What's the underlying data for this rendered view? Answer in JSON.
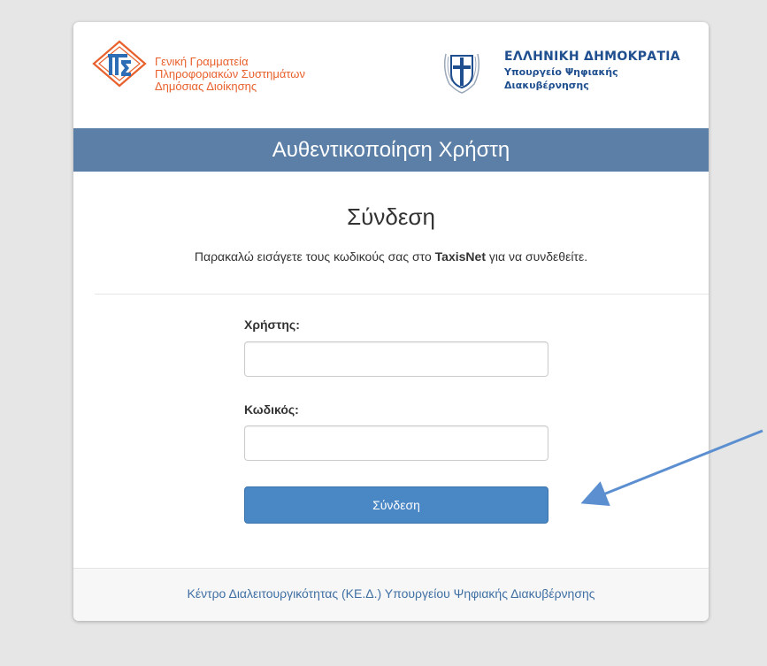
{
  "header": {
    "org_logo": {
      "icon": "gsis-logo-icon",
      "lines": [
        "Γενική Γραμματεία",
        "Πληροφοριακών Συστημάτων",
        "Δημόσιας Διοίκησης"
      ],
      "color": "#e8602c"
    },
    "gov_logo": {
      "icon": "greek-emblem-icon",
      "title": "ΕΛΛΗΝΙΚΗ ΔΗΜΟΚΡΑΤΙΑ",
      "subtitle_lines": [
        "Υπουργείο Ψηφιακής",
        "Διακυβέρνησης"
      ],
      "color": "#1f4f8f"
    }
  },
  "banner": {
    "title": "Αυθεντικοποίηση Χρήστη",
    "color": "#5b7fa6"
  },
  "login": {
    "heading": "Σύνδεση",
    "instruction_before": "Παρακαλώ εισάγετε τους κωδικούς σας στο ",
    "instruction_bold": "TaxisNet",
    "instruction_after": " για να συνδεθείτε.",
    "username_label": "Χρήστης:",
    "username_value": "",
    "password_label": "Κωδικός:",
    "password_value": "",
    "submit_label": "Σύνδεση",
    "button_color": "#4a87c5"
  },
  "footer": {
    "text": "Κέντρο Διαλειτουργικότητας (ΚΕ.Δ.) Υπουργείου Ψηφιακής Διακυβέρνησης",
    "color": "#3f6fa3"
  },
  "annotation": {
    "arrow_icon": "annotation-arrow-icon",
    "color": "#5b8fd0"
  }
}
